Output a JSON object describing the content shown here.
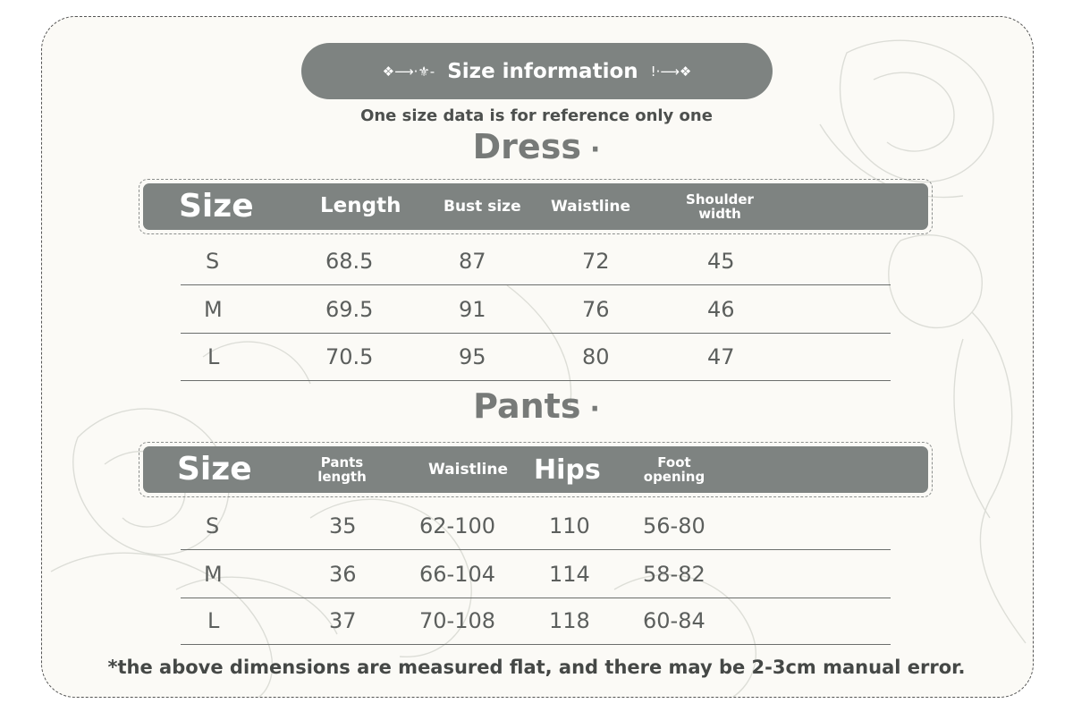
{
  "title": {
    "left_ornament": "❖⟶·⚜‑",
    "text": "Size information",
    "right_ornament": "!·⟶❖"
  },
  "subtitle": "One size data is for reference only one",
  "dress": {
    "heading": "Dress",
    "heading_dot": "·",
    "headers": [
      "Size",
      "Length",
      "Bust size",
      "Waistline",
      "Shoulder width"
    ],
    "rows": [
      [
        "S",
        "68.5",
        "87",
        "72",
        "45"
      ],
      [
        "M",
        "69.5",
        "91",
        "76",
        "46"
      ],
      [
        "L",
        "70.5",
        "95",
        "80",
        "47"
      ]
    ]
  },
  "pants": {
    "heading": "Pants",
    "heading_dot": "·",
    "headers": [
      "Size",
      "Pants length",
      "Waistline",
      "Hips",
      "Foot opening"
    ],
    "rows": [
      [
        "S",
        "35",
        "62-100",
        "110",
        "56-80"
      ],
      [
        "M",
        "36",
        "66-104",
        "114",
        "58-82"
      ],
      [
        "L",
        "37",
        "70-108",
        "118",
        "60-84"
      ]
    ]
  },
  "footnote": "*the above dimensions are measured flat, and there may be 2-3cm manual error.",
  "colors": {
    "header_bar": "#7e8381",
    "background": "#fbfaf6",
    "text": "#5c5f5d"
  }
}
